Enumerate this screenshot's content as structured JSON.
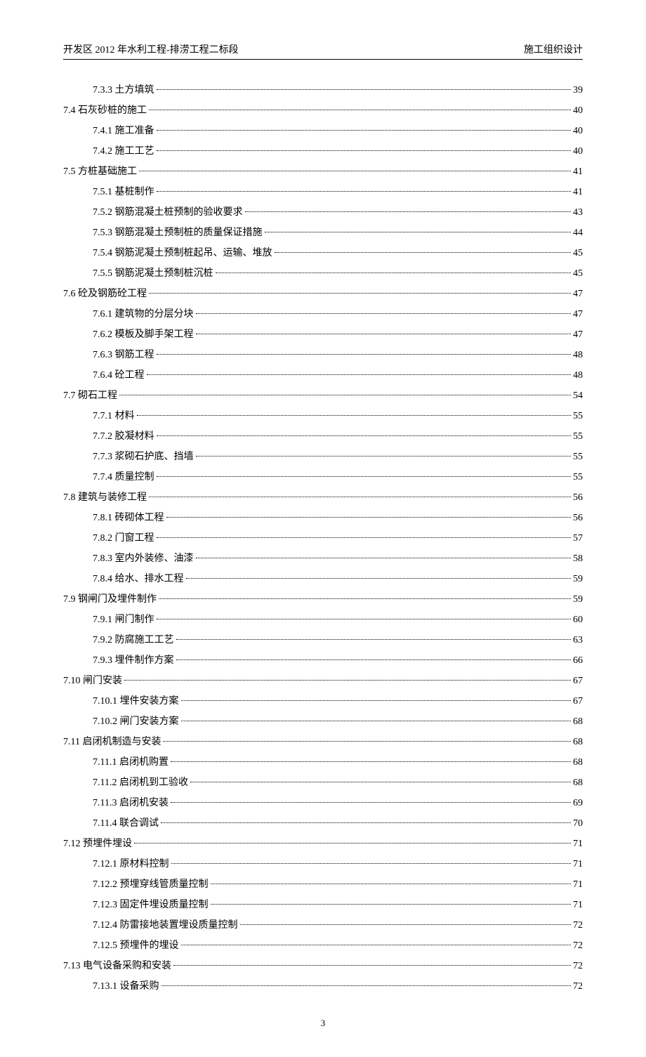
{
  "header": {
    "left": "开发区 2012 年水利工程-排涝工程二标段",
    "right": "施工组织设计"
  },
  "toc": [
    {
      "level": 2,
      "label": "7.3.3 土方填筑",
      "page": "39"
    },
    {
      "level": 1,
      "label": "7.4 石灰砂桩的施工",
      "page": "40"
    },
    {
      "level": 2,
      "label": "7.4.1 施工准备",
      "page": "40"
    },
    {
      "level": 2,
      "label": "7.4.2 施工工艺",
      "page": "40"
    },
    {
      "level": 1,
      "label": "7.5 方桩基础施工",
      "page": "41"
    },
    {
      "level": 2,
      "label": "7.5.1 基桩制作",
      "page": "41"
    },
    {
      "level": 2,
      "label": "7.5.2 钢筋混凝土桩预制的验收要求",
      "page": "43"
    },
    {
      "level": 2,
      "label": "7.5.3 钢筋混凝土预制桩的质量保证措施",
      "page": "44"
    },
    {
      "level": 2,
      "label": "7.5.4 钢筋泥凝土预制桩起吊、运输、堆放",
      "page": "45"
    },
    {
      "level": 2,
      "label": "7.5.5 钢筋泥凝土预制桩沉桩",
      "page": "45"
    },
    {
      "level": 1,
      "label": "7.6 砼及钢筋砼工程",
      "page": "47"
    },
    {
      "level": 2,
      "label": "7.6.1 建筑物的分层分块",
      "page": "47"
    },
    {
      "level": 2,
      "label": "7.6.2 模板及脚手架工程",
      "page": "47"
    },
    {
      "level": 2,
      "label": "7.6.3 钢筋工程",
      "page": "48"
    },
    {
      "level": 2,
      "label": "7.6.4 砼工程",
      "page": "48"
    },
    {
      "level": 1,
      "label": "7.7 砌石工程",
      "page": "54"
    },
    {
      "level": 2,
      "label": "7.7.1 材料",
      "page": "55"
    },
    {
      "level": 2,
      "label": "7.7.2 胶凝材料",
      "page": "55"
    },
    {
      "level": 2,
      "label": "7.7.3 浆砌石护底、挡墙",
      "page": "55"
    },
    {
      "level": 2,
      "label": "7.7.4 质量控制",
      "page": "55"
    },
    {
      "level": 1,
      "label": "7.8 建筑与装修工程",
      "page": "56"
    },
    {
      "level": 2,
      "label": "7.8.1 砖砌体工程",
      "page": "56"
    },
    {
      "level": 2,
      "label": "7.8.2 门窗工程",
      "page": "57"
    },
    {
      "level": 2,
      "label": "7.8.3 室内外装修、油漆",
      "page": "58"
    },
    {
      "level": 2,
      "label": "7.8.4 给水、排水工程",
      "page": "59"
    },
    {
      "level": 1,
      "label": "7.9 钢闸门及埋件制作",
      "page": "59"
    },
    {
      "level": 2,
      "label": "7.9.1 闸门制作",
      "page": "60"
    },
    {
      "level": 2,
      "label": "7.9.2 防腐施工工艺",
      "page": "63"
    },
    {
      "level": 2,
      "label": "7.9.3 埋件制作方案",
      "page": "66"
    },
    {
      "level": 1,
      "label": "7.10 闸门安装",
      "page": "67"
    },
    {
      "level": 2,
      "label": "7.10.1 埋件安装方案",
      "page": "67"
    },
    {
      "level": 2,
      "label": "7.10.2 闸门安装方案",
      "page": "68"
    },
    {
      "level": 1,
      "label": "7.11 启闭机制造与安装",
      "page": "68"
    },
    {
      "level": 2,
      "label": "7.11.1 启闭机购置",
      "page": "68"
    },
    {
      "level": 2,
      "label": "7.11.2 启闭机到工验收",
      "page": "68"
    },
    {
      "level": 2,
      "label": "7.11.3 启闭机安装",
      "page": "69"
    },
    {
      "level": 2,
      "label": "7.11.4 联合调试",
      "page": "70"
    },
    {
      "level": 1,
      "label": "7.12 预埋件埋设",
      "page": "71"
    },
    {
      "level": 2,
      "label": "7.12.1 原材料控制",
      "page": "71"
    },
    {
      "level": 2,
      "label": "7.12.2 预埋穿线管质量控制",
      "page": "71"
    },
    {
      "level": 2,
      "label": "7.12.3 固定件埋设质量控制",
      "page": "71"
    },
    {
      "level": 2,
      "label": "7.12.4 防雷接地装置埋设质量控制",
      "page": "72"
    },
    {
      "level": 2,
      "label": "7.12.5 预埋件的埋设",
      "page": "72"
    },
    {
      "level": 1,
      "label": "7.13 电气设备采购和安装",
      "page": "72"
    },
    {
      "level": 2,
      "label": "7.13.1 设备采购",
      "page": "72"
    }
  ],
  "pageNumber": "3"
}
